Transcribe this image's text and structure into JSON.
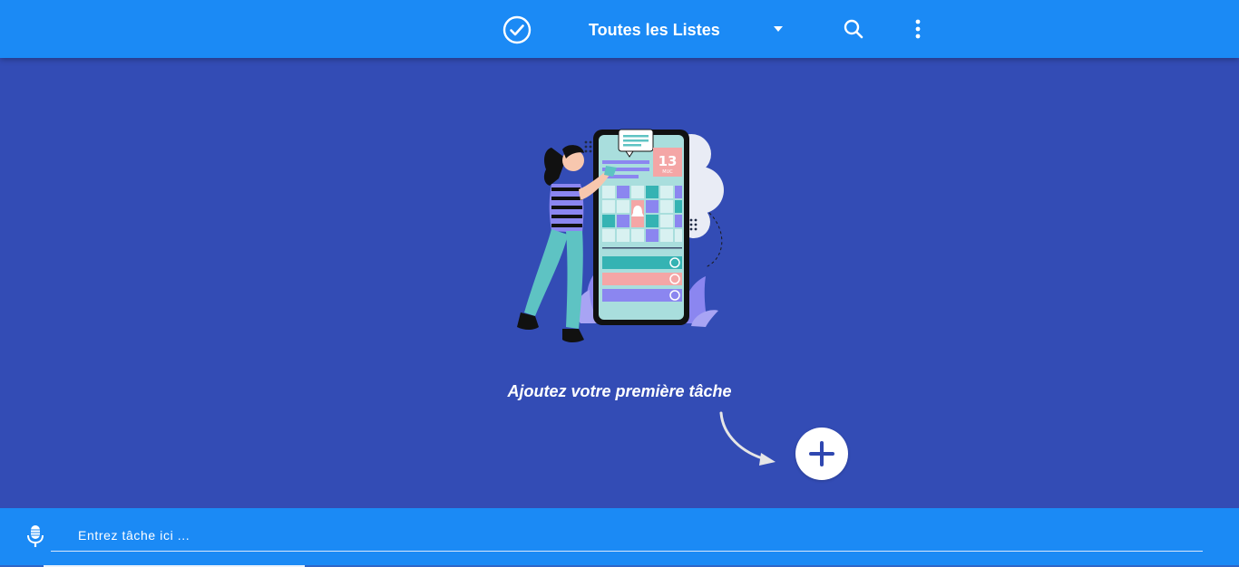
{
  "header": {
    "list_title": "Toutes les Listes",
    "icons": {
      "check": "check-circle-icon",
      "dropdown": "caret-down-icon",
      "search": "search-icon",
      "more": "more-vertical-icon"
    }
  },
  "empty_state": {
    "message": "Ajoutez votre première tâche",
    "illustration_calendar_text": "13",
    "illustration_calendar_sub": "MUC"
  },
  "footer": {
    "task_placeholder": "Entrez tâche ici ...",
    "icons": {
      "mic": "microphone-icon",
      "add": "plus-icon"
    }
  },
  "colors": {
    "toolbar": "#1b8af5",
    "background": "#334cb5",
    "add_button": "#ffffff",
    "add_icon": "#2f47b0"
  }
}
